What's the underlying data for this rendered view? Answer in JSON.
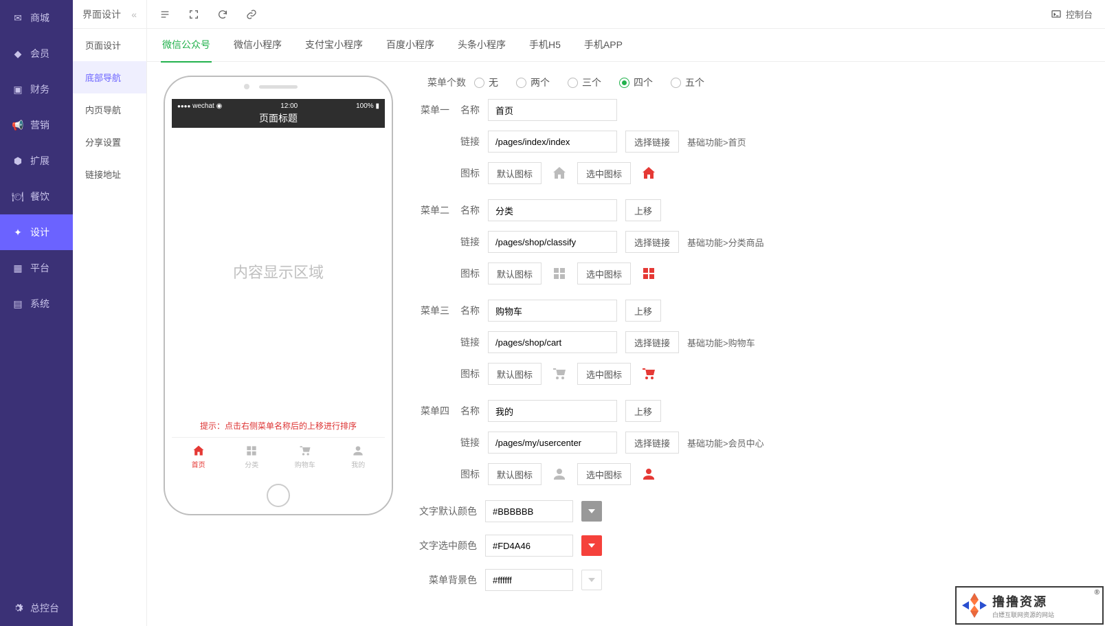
{
  "sidebar": {
    "items": [
      {
        "id": "mall",
        "label": "商城"
      },
      {
        "id": "member",
        "label": "会员"
      },
      {
        "id": "finance",
        "label": "财务"
      },
      {
        "id": "marketing",
        "label": "营销"
      },
      {
        "id": "extend",
        "label": "扩展"
      },
      {
        "id": "catering",
        "label": "餐饮"
      },
      {
        "id": "design",
        "label": "设计"
      },
      {
        "id": "platform",
        "label": "平台"
      },
      {
        "id": "system",
        "label": "系统"
      }
    ],
    "footer": {
      "label": "总控台"
    }
  },
  "subsidebar": {
    "title": "界面设计",
    "items": [
      {
        "id": "page-design",
        "label": "页面设计"
      },
      {
        "id": "bottom-nav",
        "label": "底部导航"
      },
      {
        "id": "inner-nav",
        "label": "内页导航"
      },
      {
        "id": "share-setting",
        "label": "分享设置"
      },
      {
        "id": "link-address",
        "label": "链接地址"
      }
    ]
  },
  "topbar": {
    "console": "控制台"
  },
  "tabs": [
    {
      "label": "微信公众号"
    },
    {
      "label": "微信小程序"
    },
    {
      "label": "支付宝小程序"
    },
    {
      "label": "百度小程序"
    },
    {
      "label": "头条小程序"
    },
    {
      "label": "手机H5"
    },
    {
      "label": "手机APP"
    }
  ],
  "phone": {
    "carrier": "wechat",
    "time": "12:00",
    "battery": "100%",
    "title": "页面标题",
    "body": "内容显示区域",
    "tip": "提示：点击右侧菜单名称后的上移进行排序",
    "tabbar": [
      {
        "label": "首页"
      },
      {
        "label": "分类"
      },
      {
        "label": "购物车"
      },
      {
        "label": "我的"
      }
    ]
  },
  "form": {
    "count_label": "菜单个数",
    "count_options": [
      {
        "label": "无"
      },
      {
        "label": "两个"
      },
      {
        "label": "三个"
      },
      {
        "label": "四个"
      },
      {
        "label": "五个"
      }
    ],
    "labels": {
      "name": "名称",
      "link": "链接",
      "icon": "图标",
      "default_icon": "默认图标",
      "selected_icon": "选中图标",
      "choose_link": "选择链接",
      "move_up": "上移"
    },
    "menus": [
      {
        "title": "菜单一",
        "name": "首页",
        "link": "/pages/index/index",
        "hint": "基础功能>首页",
        "icon": "home",
        "first": true
      },
      {
        "title": "菜单二",
        "name": "分类",
        "link": "/pages/shop/classify",
        "hint": "基础功能>分类商品",
        "icon": "grid"
      },
      {
        "title": "菜单三",
        "name": "购物车",
        "link": "/pages/shop/cart",
        "hint": "基础功能>购物车",
        "icon": "cart"
      },
      {
        "title": "菜单四",
        "name": "我的",
        "link": "/pages/my/usercenter",
        "hint": "基础功能>会员中心",
        "icon": "user"
      }
    ],
    "colors": {
      "default_label": "文字默认颜色",
      "default_value": "#BBBBBB",
      "selected_label": "文字选中颜色",
      "selected_value": "#FD4A46",
      "bg_label": "菜单背景色",
      "bg_value": "#ffffff"
    }
  },
  "watermark": {
    "brand": "撸撸资源",
    "sub": "白嫖互联网资源的网站"
  }
}
